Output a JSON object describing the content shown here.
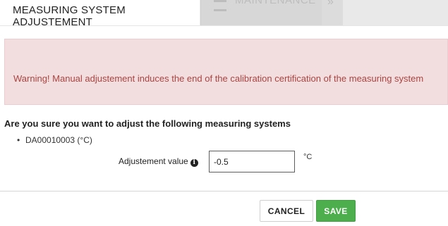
{
  "background": {
    "tab_label": "MAINTENANCE"
  },
  "modal": {
    "title": "MEASURING SYSTEM ADJUSTEMENT",
    "warning": "Warning! Manual adjustement induces the end of the calibration certification of the measuring system",
    "question": "Are you sure you want to adjust the following measuring systems",
    "systems": [
      "DA00010003 (°C)"
    ],
    "field": {
      "label": "Adjustement value",
      "value": "-0.5",
      "unit": "°C"
    },
    "buttons": {
      "cancel": "CANCEL",
      "save": "SAVE"
    }
  },
  "colors": {
    "alert_bg": "#f2dede",
    "alert_text": "#a94442",
    "save_button": "#4cae4c"
  }
}
